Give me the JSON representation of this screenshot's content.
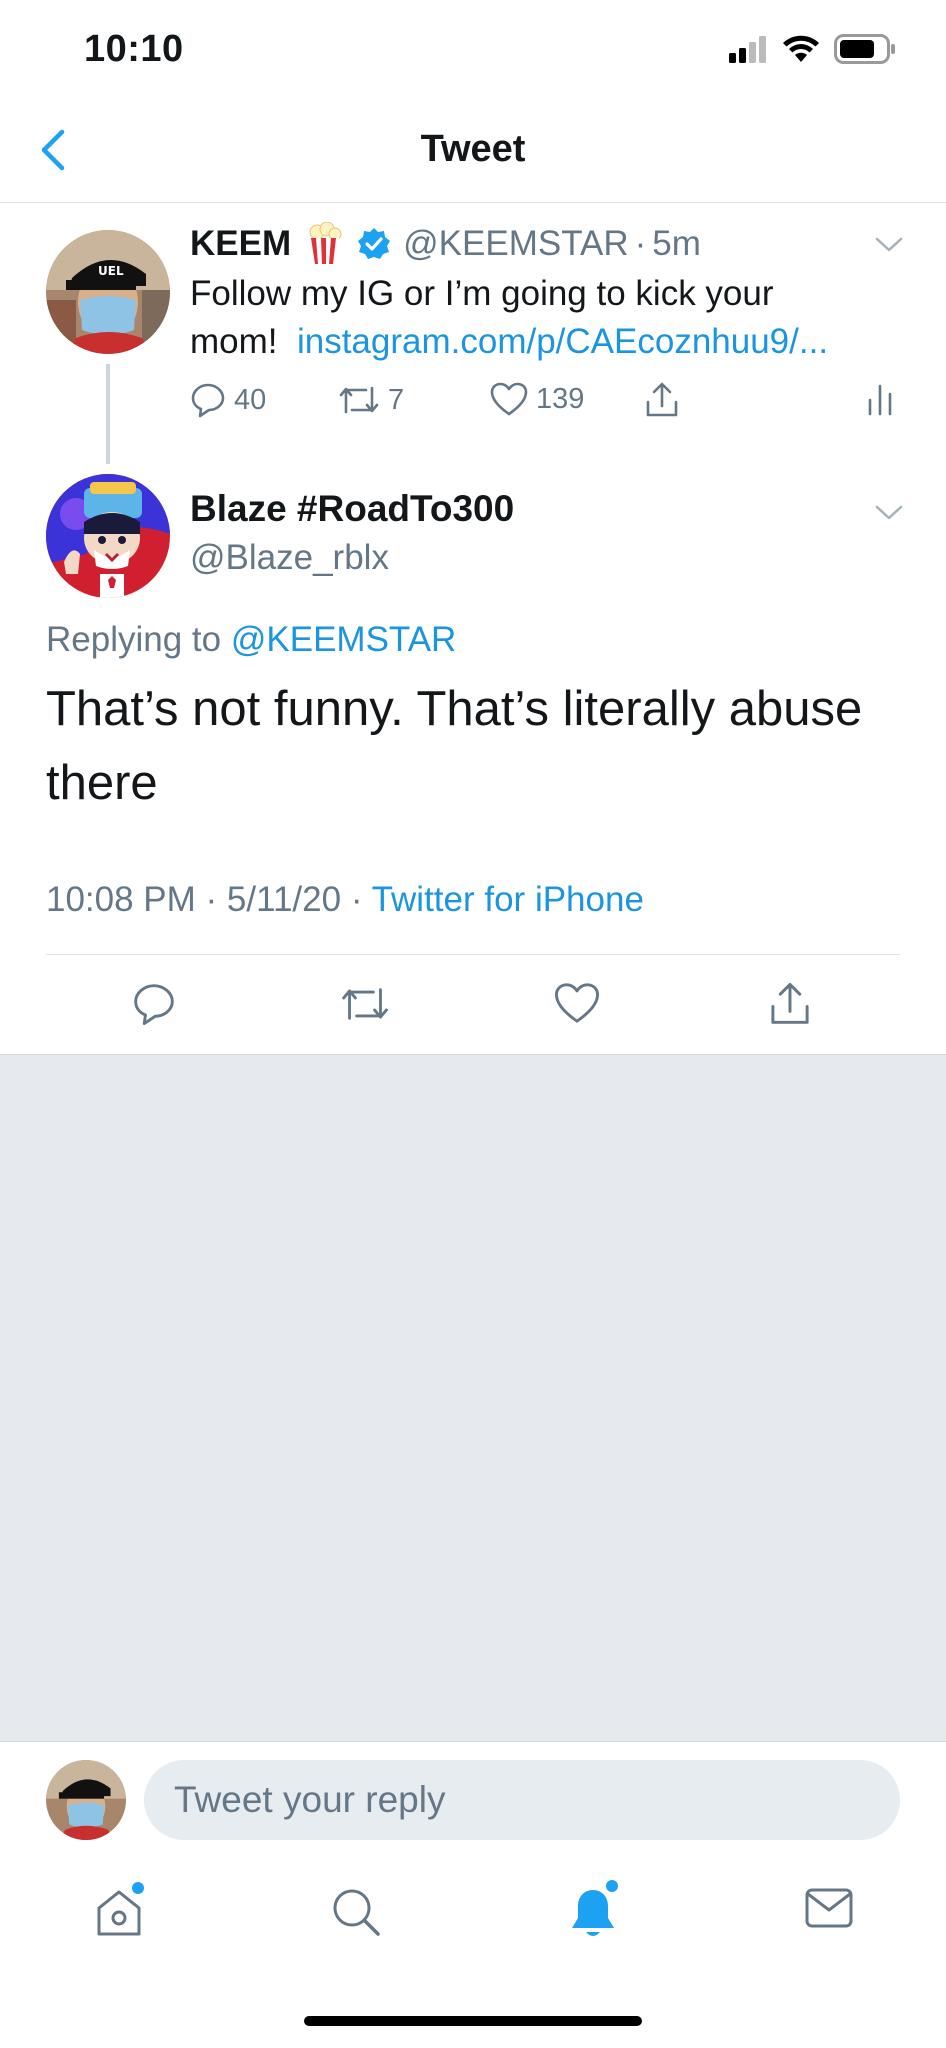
{
  "status_bar": {
    "time": "10:10"
  },
  "nav": {
    "title": "Tweet"
  },
  "parent_tweet": {
    "name": "KEEM",
    "name_emoji": "popcorn",
    "verified": true,
    "handle": "@KEEMSTAR",
    "separator": "·",
    "time_ago": "5m",
    "text_line1": "Follow my IG or I’m going to kick your",
    "text_line2": "mom!",
    "link": "instagram.com/p/CAEcoznhuu9/...",
    "stats": {
      "replies": "40",
      "retweets": "7",
      "likes": "139"
    }
  },
  "reply_tweet": {
    "name": "Blaze #RoadTo300",
    "handle": "@Blaze_rblx",
    "replying_prefix": "Replying to",
    "replying_to": "@KEEMSTAR",
    "text": "That’s not funny. That’s literally abuse there",
    "timestamp": "10:08 PM · 5/11/20 ·",
    "source": "Twitter for iPhone"
  },
  "reply_bar": {
    "placeholder": "Tweet your reply"
  },
  "colors": {
    "accent": "#1da1f2",
    "link": "#1b95e0",
    "muted": "#657786",
    "grey_bg": "#e6e9ee"
  },
  "icons": {
    "tabs": [
      "home-icon",
      "search-icon",
      "notifications-icon",
      "messages-icon"
    ]
  }
}
